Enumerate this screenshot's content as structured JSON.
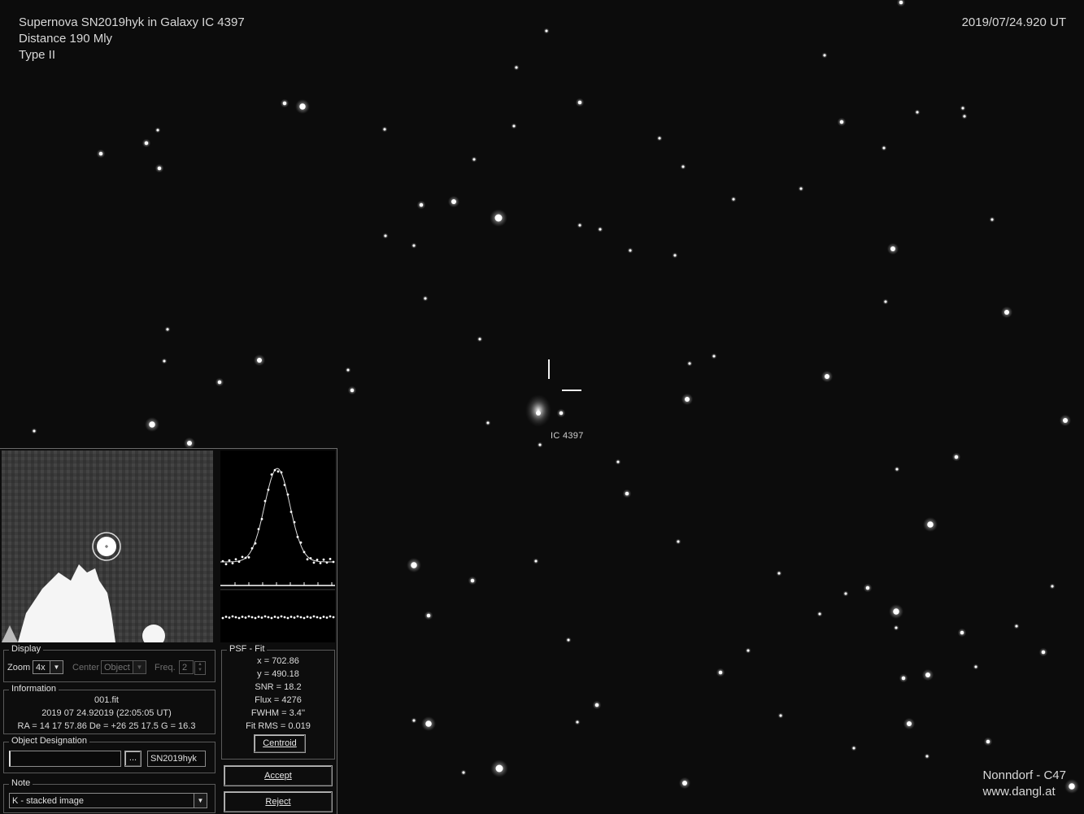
{
  "caption": {
    "title": "Supernova SN2019hyk in Galaxy IC 4397",
    "distance": "Distance 190 Mly",
    "type": "Type II",
    "timestamp": "2019/07/24.920 UT",
    "credit_line1": "Nonndorf - C47",
    "credit_line2": "www.dangl.at"
  },
  "sky": {
    "galaxy_label": "IC 4397"
  },
  "display": {
    "title": "Display",
    "zoom_label": "Zoom",
    "zoom_value": "4x",
    "center_label": "Center",
    "center_value": "Object",
    "freq_label": "Freq.",
    "freq_value": "2"
  },
  "information": {
    "title": "Information",
    "filename": "001.fit",
    "date": "2019 07 24.92019 (22:05:05 UT)",
    "coords": "RA = 14 17 57.86   De = +26 25 17.5   G = 16.3"
  },
  "object_designation": {
    "title": "Object Designation",
    "input_value": "",
    "browse_label": "...",
    "designation": "SN2019hyk"
  },
  "note": {
    "title": "Note",
    "value": "K - stacked image"
  },
  "psf_fit": {
    "title": "PSF - Fit",
    "x": "x = 702.86",
    "y": "y = 490.18",
    "snr": "SNR = 18.2",
    "flux": "Flux = 4276",
    "fwhm": "FWHM = 3.4''",
    "fit_rms": "Fit RMS = 0.019",
    "centroid_label": "Centroid"
  },
  "buttons": {
    "accept_label": "Accept",
    "reject_label": "Reject"
  }
}
